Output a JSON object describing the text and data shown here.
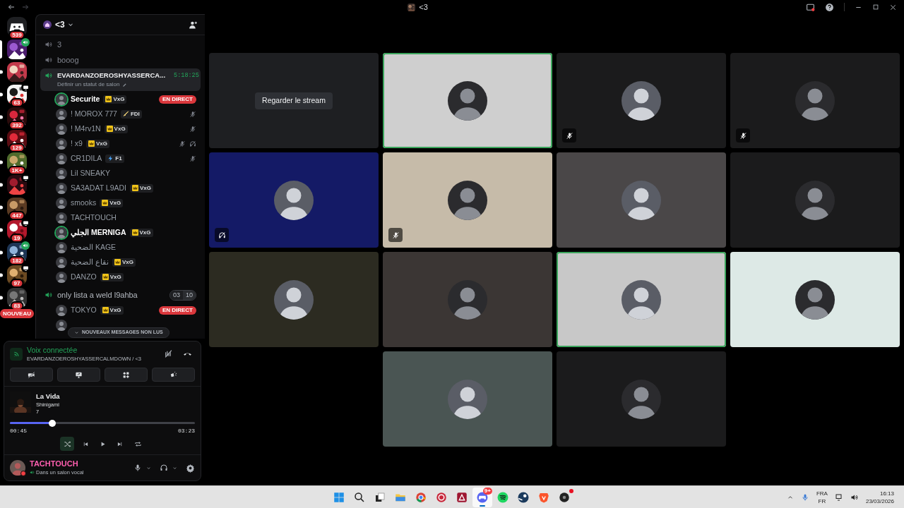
{
  "title_bar": {
    "title": "<3"
  },
  "rail": {
    "servers": [
      {
        "kind": "home",
        "badge": "539",
        "selected": false,
        "unread": false
      },
      {
        "kind": "picture",
        "selected": true,
        "in_voice": true
      },
      {
        "kind": "picture",
        "selected": false,
        "unread": true
      },
      {
        "kind": "picture",
        "badge": "63",
        "selected": false,
        "unread": true,
        "streaming": true
      },
      {
        "kind": "picture",
        "badge": "392",
        "selected": false,
        "unread": true
      },
      {
        "kind": "picture",
        "badge": "129",
        "selected": false,
        "unread": true
      },
      {
        "kind": "picture",
        "badge": "1K+",
        "selected": false,
        "unread": true
      },
      {
        "kind": "picture",
        "selected": false,
        "unread": true,
        "streaming": true
      },
      {
        "kind": "picture",
        "badge": "447",
        "selected": false,
        "unread": true
      },
      {
        "kind": "picture",
        "badge": "19",
        "selected": false,
        "unread": true,
        "streaming": true
      },
      {
        "kind": "picture",
        "badge": "182",
        "selected": false,
        "unread": true,
        "in_voice": true
      },
      {
        "kind": "picture",
        "badge": "97",
        "selected": false,
        "unread": true,
        "streaming": true
      },
      {
        "kind": "picture",
        "badge": "83",
        "selected": false,
        "unread": true
      }
    ],
    "new_label": "NOUVEAU"
  },
  "server": {
    "name": "<3"
  },
  "channels": [
    {
      "name": "3",
      "selected": false
    },
    {
      "name": "booog",
      "selected": false
    },
    {
      "name": "EVARDANZOEROSHYASSERCA...",
      "selected": true,
      "timer": "5:18:25",
      "status_placeholder": "Définir un statut de salon",
      "members": [
        {
          "name": "Securite",
          "speaking": true,
          "tag": {
            "kind": "crown",
            "text": "VxG"
          },
          "live": "EN DIRECT",
          "muted": false,
          "deafened": false
        },
        {
          "name": "! MOROX 777",
          "speaking": false,
          "tag": {
            "kind": "sword",
            "text": "FDI"
          },
          "muted": true,
          "deafened": false
        },
        {
          "name": "! M4rv1N",
          "speaking": false,
          "tag": {
            "kind": "crown",
            "text": "VxG"
          },
          "muted": true,
          "deafened": false
        },
        {
          "name": "! x9",
          "speaking": false,
          "tag": {
            "kind": "crown",
            "text": "VxG"
          },
          "muted": true,
          "deafened": true
        },
        {
          "name": "CR1DILA",
          "speaking": false,
          "tag": {
            "kind": "bolt",
            "text": "F1"
          },
          "muted": true,
          "deafened": false
        },
        {
          "name": "Lil SNEAKY",
          "speaking": false,
          "muted": false,
          "deafened": false
        },
        {
          "name": "SA3ADAT L9ADI",
          "speaking": false,
          "tag": {
            "kind": "crown",
            "text": "VxG"
          },
          "muted": false,
          "deafened": false
        },
        {
          "name": "smooks",
          "speaking": false,
          "tag": {
            "kind": "crown",
            "text": "VxG"
          },
          "muted": false,
          "deafened": false
        },
        {
          "name": "TACHTOUCH",
          "speaking": false,
          "muted": false,
          "deafened": false
        },
        {
          "name": "الجلي MERNIGA",
          "speaking": true,
          "tag": {
            "kind": "crown",
            "text": "VxG"
          },
          "muted": false,
          "deafened": false
        },
        {
          "name": "الضحية KAGE",
          "speaking": false,
          "muted": false,
          "deafened": false
        },
        {
          "name": "نقاع الضحية",
          "speaking": false,
          "tag": {
            "kind": "crown",
            "text": "VxG"
          },
          "muted": false,
          "deafened": false
        },
        {
          "name": "DANZO",
          "speaking": false,
          "tag": {
            "kind": "crown",
            "text": "VxG"
          },
          "muted": false,
          "deafened": false
        }
      ]
    },
    {
      "name": "only lista a weld l9ahba",
      "selected": false,
      "counts": [
        "03",
        "10"
      ],
      "members": [
        {
          "name": "TOKYO",
          "speaking": false,
          "tag": {
            "kind": "crown",
            "text": "VxG"
          },
          "live": "EN DIRECT",
          "muted": false,
          "deafened": false
        },
        {
          "speaking": false,
          "muted": false,
          "deafened": false
        }
      ]
    }
  ],
  "unread_banner": "NOUVEAUX MESSAGES NON LUS",
  "voice_panel": {
    "status": "Voix connectée",
    "channel": "EVARDANZOEROSHYASSERCALMDOWN / <3"
  },
  "music": {
    "title": "La Vida",
    "artist": "Shinigami",
    "album": "7",
    "level": 0.23,
    "elapsed": "00:45",
    "duration": "03:23",
    "shuffle": true
  },
  "user": {
    "name": "TACHTOUCH",
    "status": "Dans un salon vocal"
  },
  "tiles": [
    {
      "kind": "stream",
      "button": "Regarder le stream",
      "color": "#1e1f22",
      "speaking": false
    },
    {
      "kind": "avatar",
      "color": "#cfcfcf",
      "speaking": true,
      "muted": false,
      "deafened": false
    },
    {
      "kind": "avatar",
      "color": "#1b1b1c",
      "speaking": false,
      "muted": true,
      "deafened": false
    },
    {
      "kind": "avatar",
      "color": "#1b1b1c",
      "speaking": false,
      "muted": true,
      "deafened": false
    },
    {
      "kind": "avatar",
      "color": "#141a66",
      "speaking": false,
      "muted": false,
      "deafened": true
    },
    {
      "kind": "avatar",
      "color": "#c6bba9",
      "speaking": false,
      "muted": true,
      "deafened": false
    },
    {
      "kind": "avatar",
      "color": "#4a4748",
      "speaking": false,
      "muted": false,
      "deafened": false
    },
    {
      "kind": "avatar",
      "color": "#1b1b1c",
      "speaking": false,
      "muted": false,
      "deafened": false
    },
    {
      "kind": "avatar",
      "color": "#2c2b21",
      "speaking": false,
      "muted": false,
      "deafened": false
    },
    {
      "kind": "avatar",
      "color": "#3b3634",
      "speaking": false,
      "muted": false,
      "deafened": false
    },
    {
      "kind": "avatar",
      "color": "#c8c8c8",
      "speaking": true,
      "muted": false,
      "deafened": false
    },
    {
      "kind": "avatar",
      "color": "#dde9e6",
      "speaking": false,
      "muted": false,
      "deafened": false
    },
    {
      "kind": "avatar",
      "color": "#4a5553",
      "speaking": false,
      "muted": false,
      "deafened": false
    },
    {
      "kind": "avatar",
      "color": "#1b1b1c",
      "speaking": false,
      "muted": false,
      "deafened": false
    }
  ],
  "taskbar": {
    "apps": [
      {
        "kind": "start",
        "selected": false
      },
      {
        "kind": "search",
        "selected": false
      },
      {
        "kind": "taskview",
        "selected": false
      },
      {
        "kind": "folder",
        "selected": false
      },
      {
        "kind": "chrome",
        "selected": false
      },
      {
        "kind": "red-circle",
        "selected": false
      },
      {
        "kind": "red-square",
        "selected": false
      },
      {
        "kind": "discord",
        "selected": true,
        "badge": "9+"
      },
      {
        "kind": "spotify",
        "selected": false
      },
      {
        "kind": "steam",
        "selected": false
      },
      {
        "kind": "brave",
        "selected": false
      },
      {
        "kind": "dark-circle",
        "selected": false,
        "alert": true
      }
    ],
    "lang": "FRA",
    "layout": "FR",
    "time": "16:13",
    "date": "23/03/2026"
  }
}
